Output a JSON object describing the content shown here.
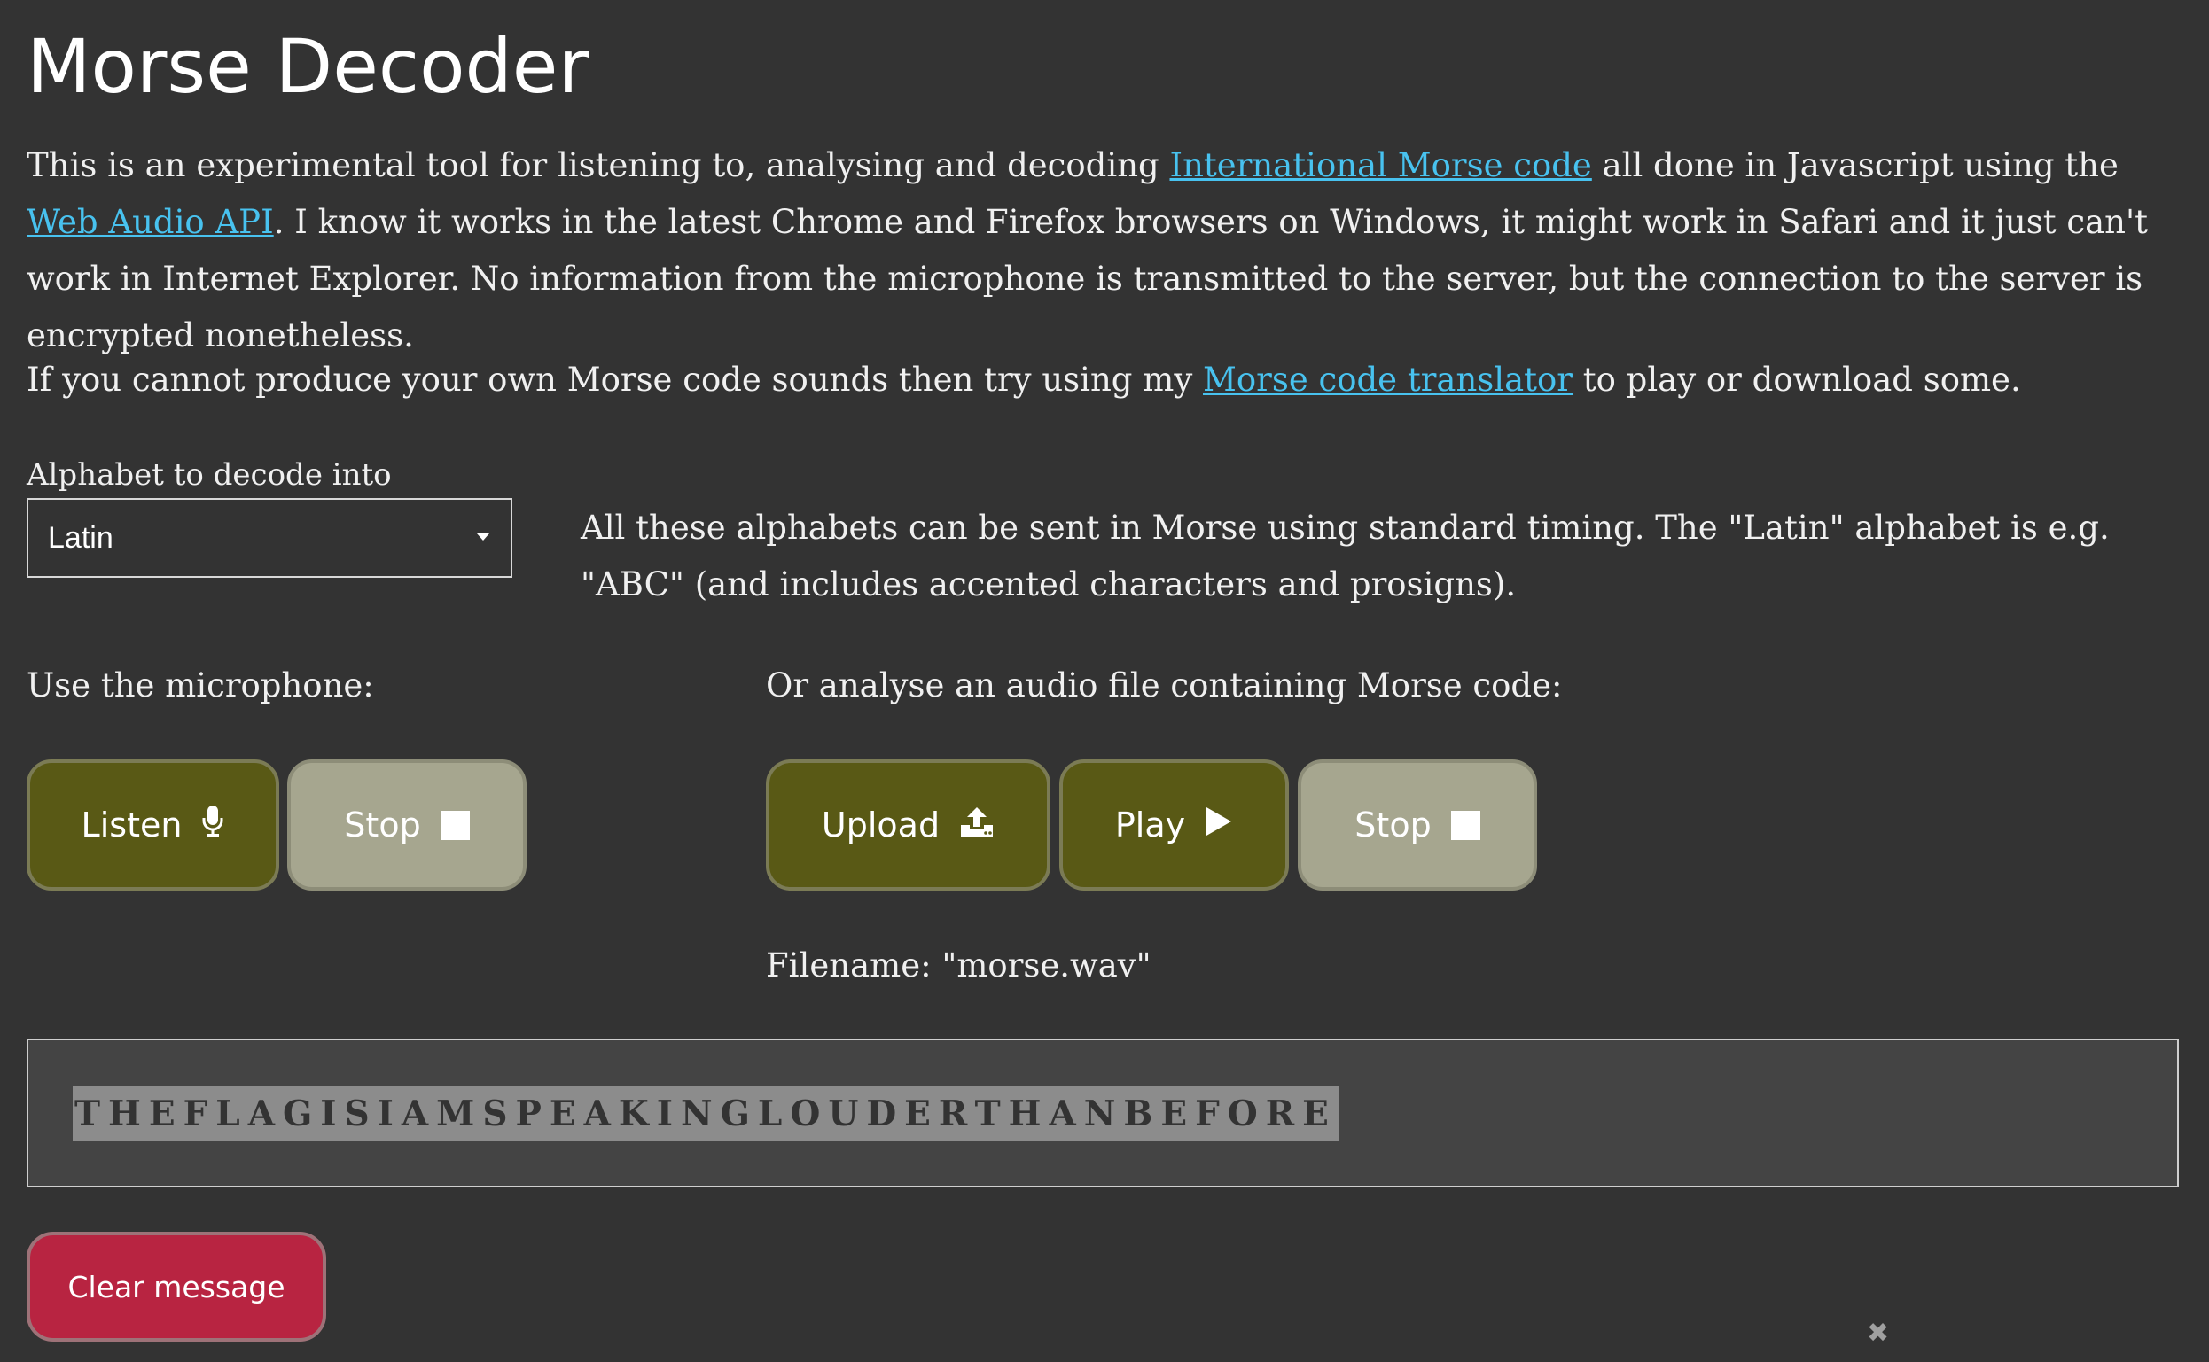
{
  "page": {
    "title": "Morse Decoder"
  },
  "intro": {
    "part1": "This is an experimental tool for listening to, analysing and decoding ",
    "link1": "International Morse code",
    "part2": " all done in Javascript using the ",
    "link2": "Web Audio API",
    "part3": ". I know it works in the latest Chrome and Firefox browsers on Windows, it might work in Safari and it just can't work in Internet Explorer. No information from the microphone is transmitted to the server, but the connection to the server is encrypted nonetheless."
  },
  "translator": {
    "before": "If you cannot produce your own Morse code sounds then try using my ",
    "link": "Morse code translator",
    "after": " to play or download some."
  },
  "alphabet": {
    "label": "Alphabet to decode into",
    "selected": "Latin",
    "note": "All these alphabets can be sent in Morse using standard timing. The \"Latin\" alphabet is e.g. \"ABC\" (and includes accented characters and prosigns)."
  },
  "microphone": {
    "label": "Use the microphone:",
    "listen_label": "Listen",
    "stop_label": "Stop"
  },
  "file": {
    "label": "Or analyse an audio file containing Morse code:",
    "upload_label": "Upload",
    "play_label": "Play",
    "stop_label": "Stop",
    "filename_text": "Filename: \"morse.wav\""
  },
  "output": {
    "message": "THEFLAGISIAMSPEAKINGLOUDERTHANBEFORE",
    "clear_label": "Clear message"
  },
  "icons": {
    "microphone": "microphone-icon",
    "stop": "stop-square-icon",
    "upload": "upload-icon",
    "play": "play-triangle-icon",
    "close": "close-icon"
  },
  "colors": {
    "background": "#333333",
    "link": "#48c2ef",
    "button_active": "#595915",
    "button_inactive": "#a6a68f",
    "button_danger": "#b82441"
  }
}
